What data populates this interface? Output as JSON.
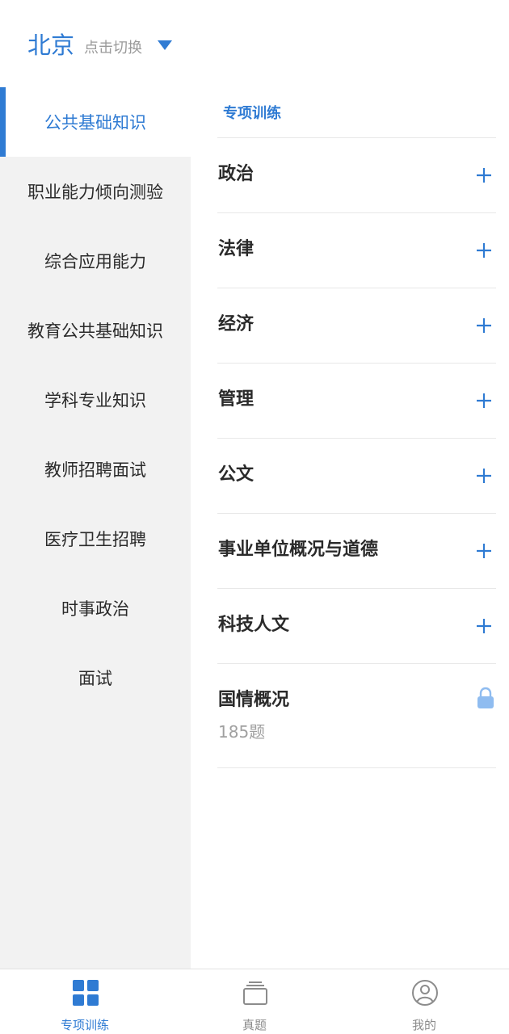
{
  "header": {
    "city": "北京",
    "switch_hint": "点击切换"
  },
  "sidebar": {
    "items": [
      {
        "label": "公共基础知识",
        "active": true
      },
      {
        "label": "职业能力倾向测验"
      },
      {
        "label": "综合应用能力"
      },
      {
        "label": "教育公共基础知识"
      },
      {
        "label": "学科专业知识"
      },
      {
        "label": "教师招聘面试"
      },
      {
        "label": "医疗卫生招聘"
      },
      {
        "label": "时事政治"
      },
      {
        "label": "面试"
      }
    ]
  },
  "main": {
    "section_title": "专项训练",
    "subjects": [
      {
        "name": "政治",
        "icon": "plus-icon"
      },
      {
        "name": "法律",
        "icon": "plus-icon"
      },
      {
        "name": "经济",
        "icon": "plus-icon"
      },
      {
        "name": "管理",
        "icon": "plus-icon"
      },
      {
        "name": "公文",
        "icon": "plus-icon"
      },
      {
        "name": "事业单位概况与道德",
        "icon": "plus-icon"
      },
      {
        "name": "科技人文",
        "icon": "plus-icon"
      },
      {
        "name": "国情概况",
        "count": "185题",
        "icon": "lock-icon"
      }
    ]
  },
  "bottom_nav": {
    "items": [
      {
        "label": "专项训练",
        "icon": "grid-icon",
        "active": true
      },
      {
        "label": "真题",
        "icon": "cards-icon"
      },
      {
        "label": "我的",
        "icon": "user-icon"
      }
    ]
  },
  "colors": {
    "accent": "#2f7bd3",
    "lock": "#8fbcf0",
    "sidebar_bg": "#f2f2f2",
    "text": "#2a2a2a",
    "muted": "#9a9a9a"
  }
}
